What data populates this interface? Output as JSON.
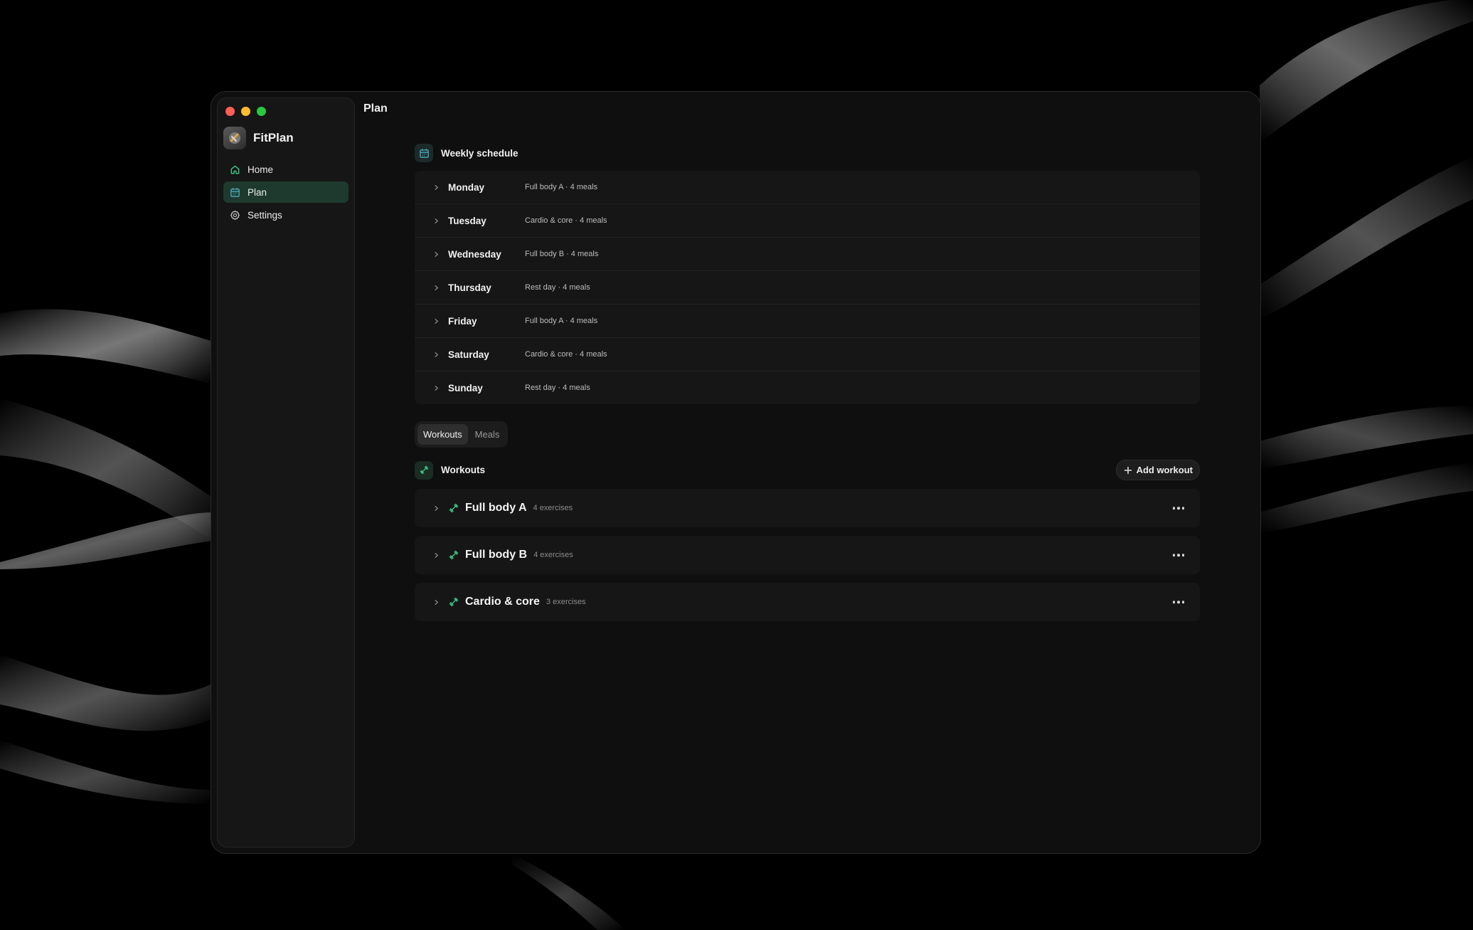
{
  "window": {
    "page_title": "Plan"
  },
  "brand": {
    "name": "FitPlan"
  },
  "sidebar": {
    "items": [
      {
        "label": "Home",
        "icon": "home-icon",
        "active": false
      },
      {
        "label": "Plan",
        "icon": "calendar-icon",
        "active": true
      },
      {
        "label": "Settings",
        "icon": "gear-icon",
        "active": false
      }
    ]
  },
  "schedule": {
    "title": "Weekly schedule",
    "days": [
      {
        "name": "Monday",
        "desc": "Full body A · 4 meals"
      },
      {
        "name": "Tuesday",
        "desc": "Cardio & core · 4 meals"
      },
      {
        "name": "Wednesday",
        "desc": "Full body B · 4 meals"
      },
      {
        "name": "Thursday",
        "desc": "Rest day · 4 meals"
      },
      {
        "name": "Friday",
        "desc": "Full body A · 4 meals"
      },
      {
        "name": "Saturday",
        "desc": "Cardio & core · 4 meals"
      },
      {
        "name": "Sunday",
        "desc": "Rest day · 4 meals"
      }
    ]
  },
  "tabs": [
    {
      "label": "Workouts",
      "active": true
    },
    {
      "label": "Meals",
      "active": false
    }
  ],
  "workouts": {
    "title": "Workouts",
    "add_label": "Add workout",
    "items": [
      {
        "name": "Full body A",
        "count": "4 exercises"
      },
      {
        "name": "Full body B",
        "count": "4 exercises"
      },
      {
        "name": "Cardio & core",
        "count": "3 exercises"
      }
    ]
  },
  "colors": {
    "accent": "#3ecf8e",
    "active_nav_bg": "#1e3a2e",
    "calendar_accent": "#4fb8c8"
  }
}
